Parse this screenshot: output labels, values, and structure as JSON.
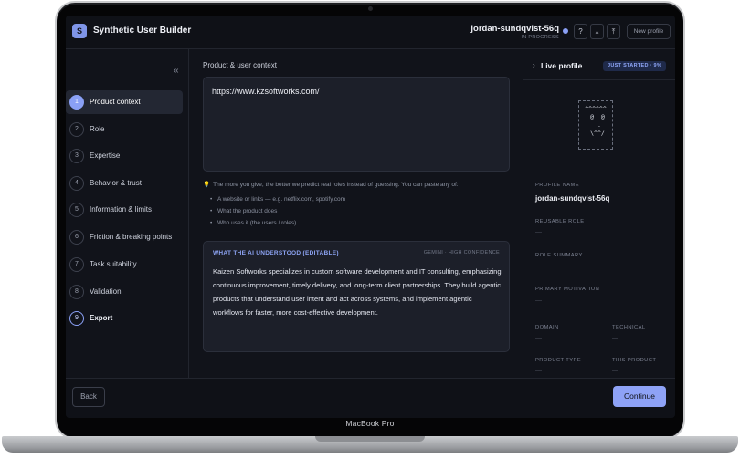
{
  "device": {
    "label": "MacBook Pro"
  },
  "header": {
    "logo_letter": "S",
    "app_title": "Synthetic User Builder",
    "profile_name": "jordan-sundqvist-56q",
    "profile_status": "IN PROGRESS",
    "buttons": {
      "help": "?",
      "download": "⤓",
      "upload": "⤒",
      "new_profile": "New profile"
    }
  },
  "sidebar": {
    "collapse": "«",
    "steps": [
      {
        "num": "1",
        "label": "Product context"
      },
      {
        "num": "2",
        "label": "Role"
      },
      {
        "num": "3",
        "label": "Expertise"
      },
      {
        "num": "4",
        "label": "Behavior & trust"
      },
      {
        "num": "5",
        "label": "Information & limits"
      },
      {
        "num": "6",
        "label": "Friction & breaking points"
      },
      {
        "num": "7",
        "label": "Task suitability"
      },
      {
        "num": "8",
        "label": "Validation"
      },
      {
        "num": "9",
        "label": "Export"
      }
    ]
  },
  "main": {
    "section_label": "Product & user context",
    "url_value": "https://www.kzsoftworks.com/",
    "hint_text": "The more you give, the better we predict real roles instead of guessing. You can paste any of:",
    "hint_items": [
      "A website or links — e.g. netflix.com, spotify.com",
      "What the product does",
      "Who uses it (the users / roles)"
    ],
    "ai": {
      "title": "WHAT THE AI UNDERSTOOD (EDITABLE)",
      "meta": "GEMINI · HIGH CONFIDENCE",
      "text": "Kaizen Softworks specializes in custom software development and IT consulting, emphasizing continuous improvement, timely delivery, and long-term client partnerships. They build agentic products that understand user intent and act across systems, and implement agentic workflows for faster, more cost-effective development."
    }
  },
  "right_panel": {
    "chevron": "›",
    "title": "Live profile",
    "badge": "JUST STARTED · 9%",
    "progress": 0.09,
    "avatar_ascii": "^^^^^^\n @  @\n  .\n \\^^/",
    "fields": {
      "profile_name_label": "PROFILE NAME",
      "profile_name_value": "jordan-sundqvist-56q",
      "reusable_role_label": "REUSABLE ROLE",
      "role_summary_label": "ROLE SUMMARY",
      "primary_motivation_label": "PRIMARY MOTIVATION",
      "domain_label": "DOMAIN",
      "technical_label": "TECHNICAL",
      "product_type_label": "PRODUCT TYPE",
      "this_product_label": "THIS PRODUCT",
      "empty": "—"
    }
  },
  "footer": {
    "back": "Back",
    "continue": "Continue"
  },
  "colors": {
    "accent": "#8ea2f6",
    "background": "#11131a",
    "panel": "#1c1f29"
  }
}
